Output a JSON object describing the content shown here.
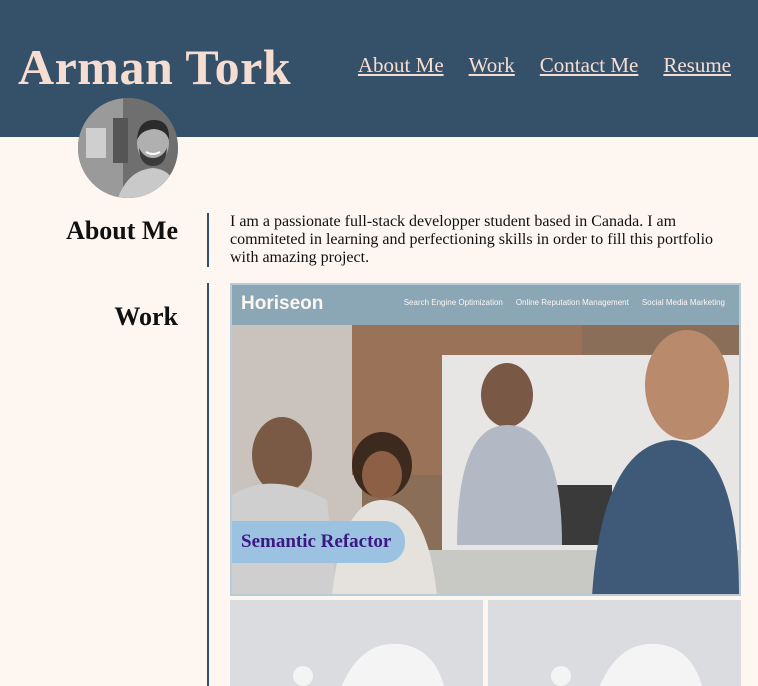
{
  "site": {
    "title": "Arman Tork"
  },
  "nav": [
    {
      "label": "About Me"
    },
    {
      "label": "Work"
    },
    {
      "label": "Contact Me"
    },
    {
      "label": "Resume"
    }
  ],
  "about": {
    "heading": "About Me",
    "text": "I am a passionate full-stack developper student based in Canada. I am commiteted in learning and perfectioning skills in order to fill this portfolio with amazing project."
  },
  "work": {
    "heading": "Work",
    "featured": {
      "label": "Semantic Refactor",
      "preview": {
        "brand": "Horiseon",
        "links": [
          "Search Engine Optimization",
          "Online Reputation Management",
          "Social Media Marketing"
        ]
      }
    }
  },
  "colors": {
    "header_bg": "#355069",
    "title_text": "#f6ddd2",
    "page_bg": "#fdf6f1",
    "label_bg": "#9bc3e1",
    "label_text": "#3c1882"
  },
  "icons": [
    "avatar-photo",
    "placeholder-image-icon"
  ]
}
